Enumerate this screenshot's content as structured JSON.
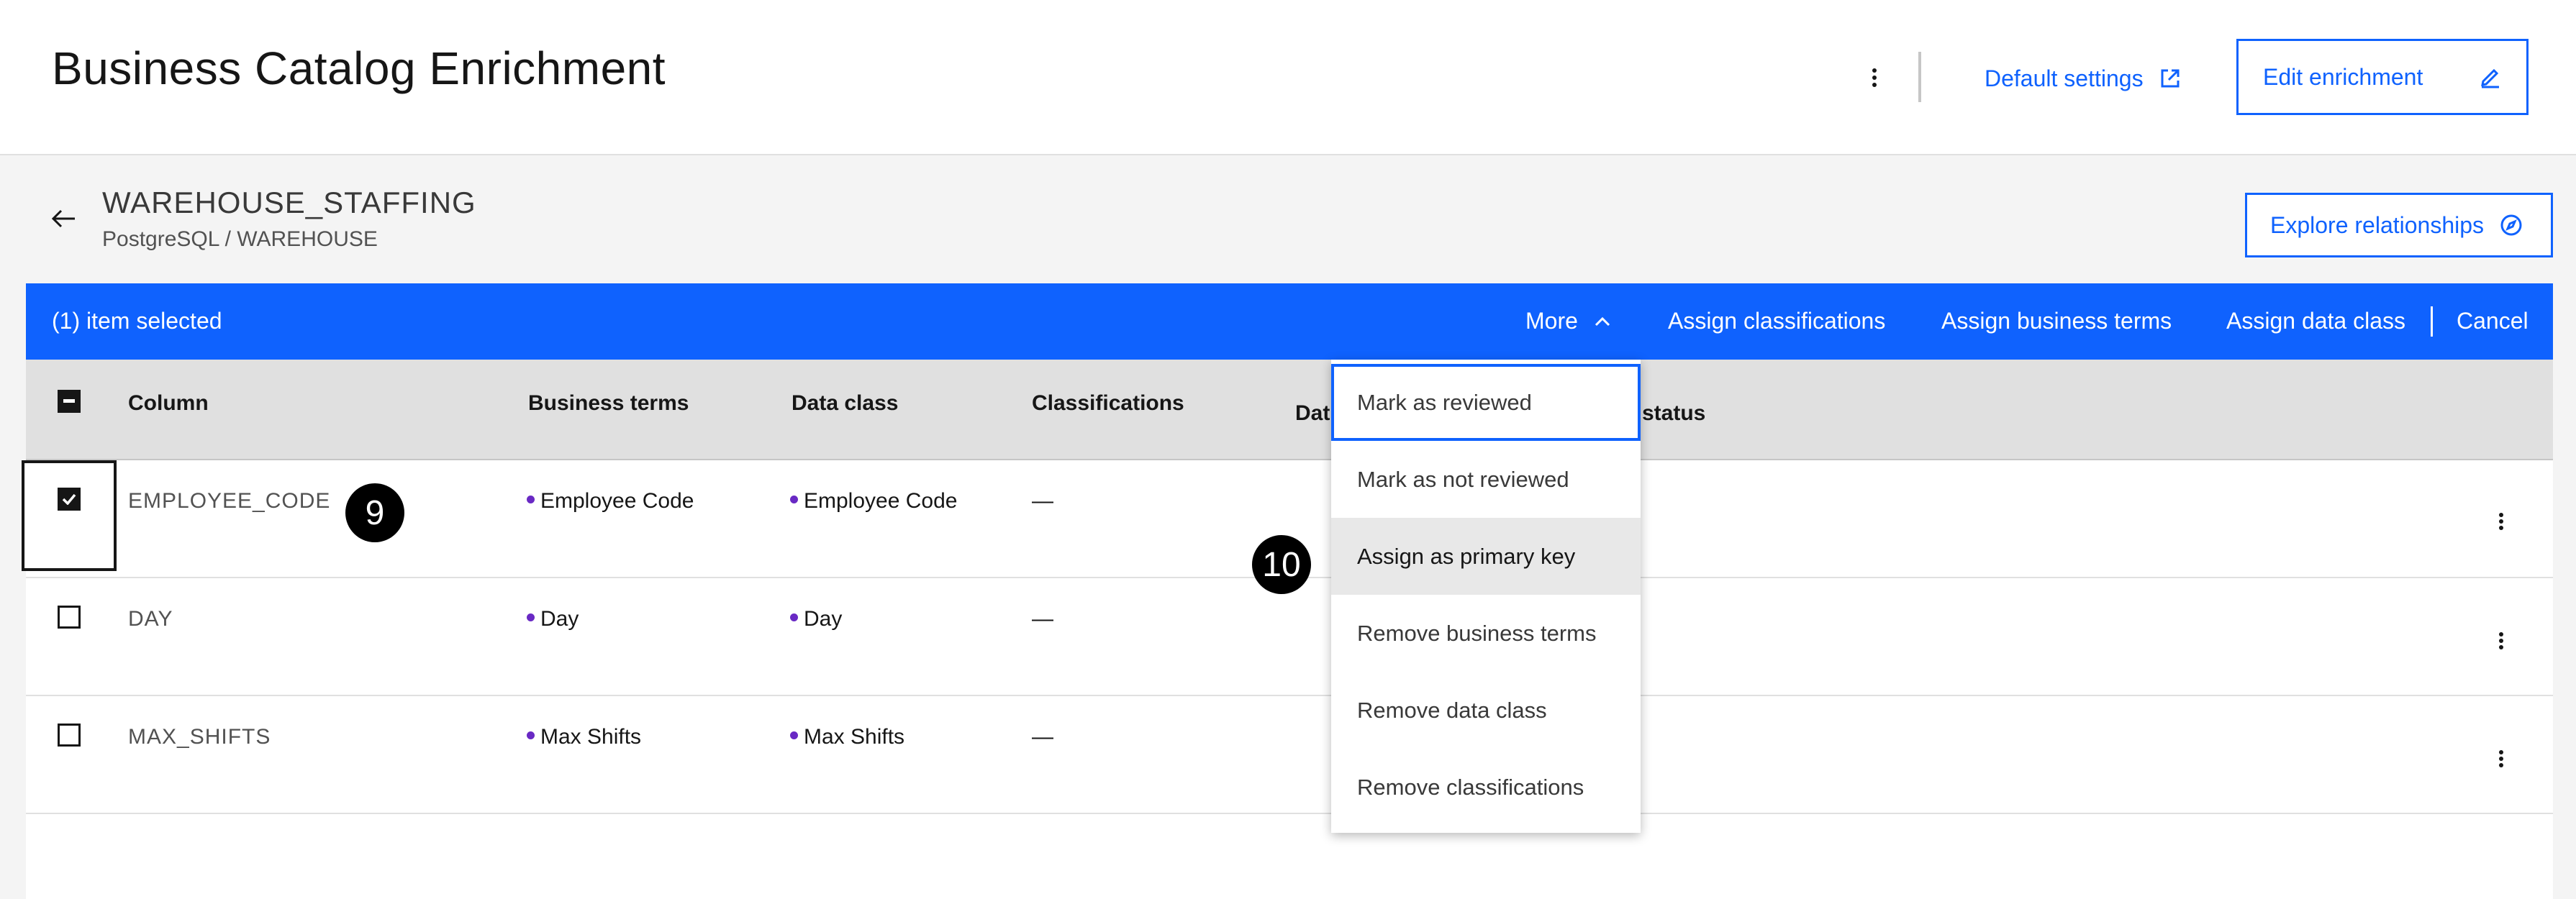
{
  "header": {
    "title": "Business Catalog Enrichment",
    "default_settings_label": "Default settings",
    "edit_enrichment_label": "Edit enrichment"
  },
  "asset": {
    "name": "WAREHOUSE_STAFFING",
    "path": "PostgreSQL / WAREHOUSE",
    "explore_label": "Explore relationships"
  },
  "batch_bar": {
    "selected_text": "(1) item selected",
    "more_label": "More",
    "assign_classifications": "Assign classifications",
    "assign_business_terms": "Assign business terms",
    "assign_data_class": "Assign data class",
    "cancel": "Cancel"
  },
  "table": {
    "headers": {
      "column": "Column",
      "business_terms": "Business terms",
      "data_class": "Data class",
      "classifications": "Classifications",
      "data_partial": "Dat",
      "status_partial": "status"
    },
    "rows": [
      {
        "column": "EMPLOYEE_CODE",
        "business_term": "Employee Code",
        "data_class": "Employee Code",
        "classifications": "—",
        "checked": true
      },
      {
        "column": "DAY",
        "business_term": "Day",
        "data_class": "Day",
        "classifications": "—",
        "checked": false
      },
      {
        "column": "MAX_SHIFTS",
        "business_term": "Max Shifts",
        "data_class": "Max Shifts",
        "classifications": "—",
        "checked": false
      }
    ]
  },
  "dropdown": {
    "items": [
      "Mark as reviewed",
      "Mark as not reviewed",
      "Assign as primary key",
      "Remove business terms",
      "Remove data class",
      "Remove classifications"
    ]
  },
  "step_badges": [
    "9",
    "10"
  ],
  "colors": {
    "accent": "#0f62fe",
    "term_dot": "#6929c4",
    "header_bg": "#e0e0e0",
    "page_bg": "#f4f4f4"
  },
  "icons": {
    "overflow": "overflow-menu-vertical-icon",
    "launch": "launch-icon",
    "edit": "edit-icon",
    "back": "arrow-left-icon",
    "explore": "compass-icon",
    "chevron": "chevron-up-icon"
  }
}
